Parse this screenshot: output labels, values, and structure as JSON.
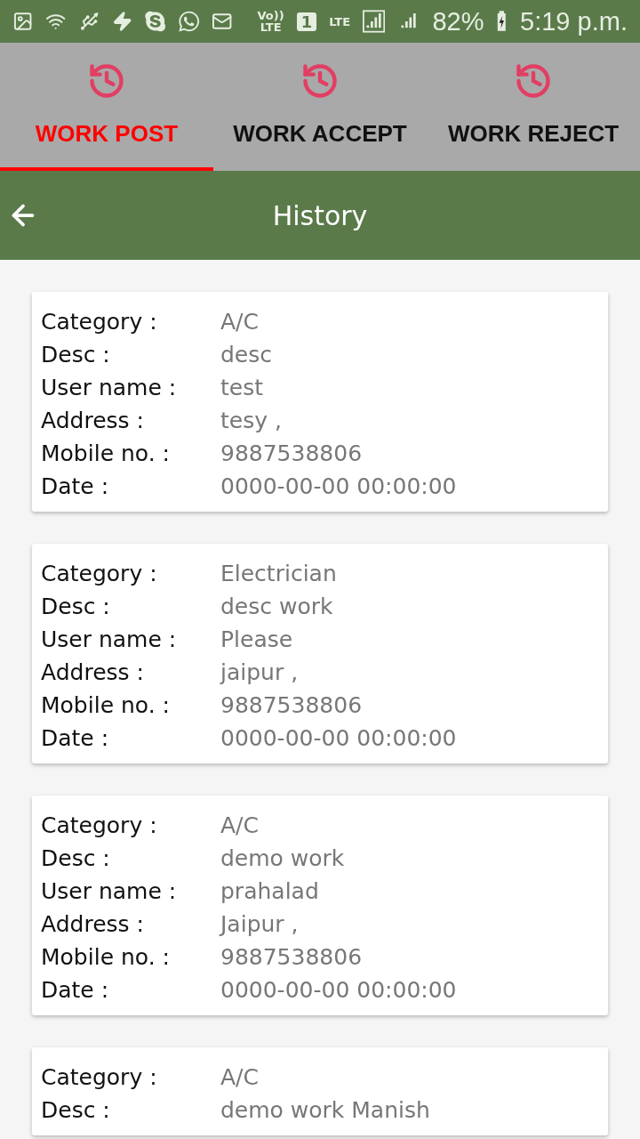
{
  "status_bar": {
    "volte": [
      "Vo))",
      "LTE"
    ],
    "sim": "1",
    "network": "LTE",
    "battery": "82%",
    "time": "5:19 p.m."
  },
  "tabs": [
    {
      "label": "WORK POST",
      "selected": true
    },
    {
      "label": "WORK ACCEPT",
      "selected": false
    },
    {
      "label": "WORK REJECT",
      "selected": false
    }
  ],
  "toolbar": {
    "title": "History"
  },
  "cards": [
    {
      "rows": [
        {
          "label": "Category :",
          "value": "A/C"
        },
        {
          "label": "Desc :",
          "value": "desc"
        },
        {
          "label": "User name :",
          "value": "test"
        },
        {
          "label": "Address :",
          "value": "tesy ,"
        },
        {
          "label": "Mobile no. :",
          "value": "9887538806"
        },
        {
          "label": "Date :",
          "value": "0000-00-00 00:00:00"
        }
      ]
    },
    {
      "rows": [
        {
          "label": "Category :",
          "value": "Electrician"
        },
        {
          "label": "Desc :",
          "value": "desc work"
        },
        {
          "label": "User name :",
          "value": "Please"
        },
        {
          "label": "Address :",
          "value": "jaipur ,"
        },
        {
          "label": "Mobile no. :",
          "value": "9887538806"
        },
        {
          "label": "Date :",
          "value": "0000-00-00 00:00:00"
        }
      ]
    },
    {
      "rows": [
        {
          "label": "Category :",
          "value": "A/C"
        },
        {
          "label": "Desc :",
          "value": "demo work"
        },
        {
          "label": "User name :",
          "value": "prahalad"
        },
        {
          "label": "Address :",
          "value": "Jaipur  ,"
        },
        {
          "label": "Mobile no. :",
          "value": "9887538806"
        },
        {
          "label": "Date :",
          "value": "0000-00-00 00:00:00"
        }
      ]
    },
    {
      "rows": [
        {
          "label": "Category :",
          "value": "A/C"
        },
        {
          "label": "Desc :",
          "value": "demo work Manish"
        }
      ]
    }
  ]
}
